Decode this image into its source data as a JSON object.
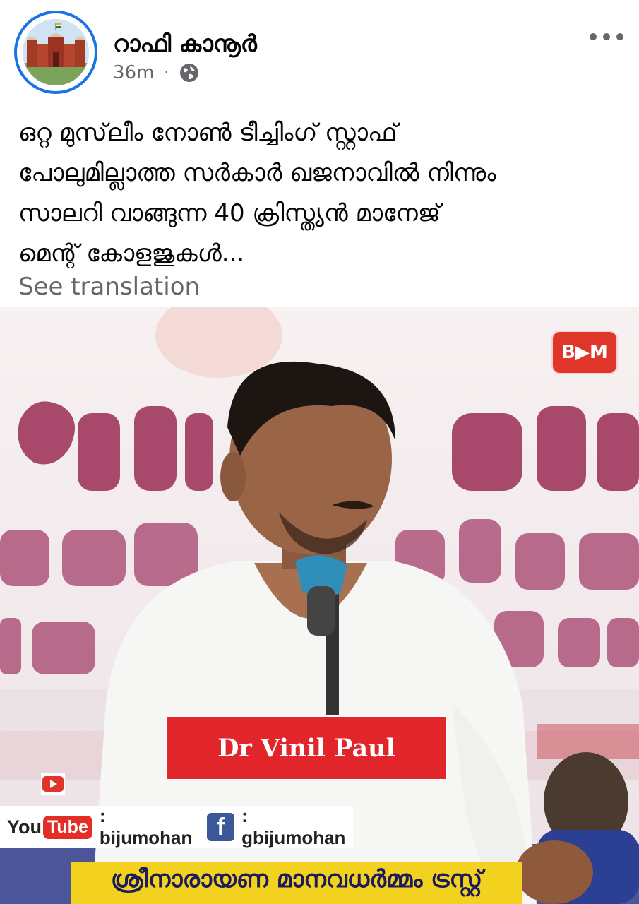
{
  "post": {
    "author": "റാഫി കാനൂർ",
    "time": "36m",
    "separator": "·",
    "text": "ഒറ്റ മുസ്‌ലീം നോൺ ടീച്ചിംഗ് സ്റ്റാഫ്\nപോലുമില്ലാത്ത സർകാർ ഖജനാവിൽ നിന്നും\nസാലറി വാങ്ങുന്ന 40 ക്രിസ്ത്യൻ മാനേജ്\nമെന്റ് കോളജുകൾ...",
    "see_translation": "See translation"
  },
  "video": {
    "logo_text": "B▶M",
    "name_plate": "Dr Vinil Paul",
    "youtube_word": "You",
    "youtube_box": "Tube",
    "youtube_handle": ": bijumohan",
    "facebook_letter": "f",
    "facebook_handle": ": gbijumohan",
    "banner_text": "ശ്രീനാരായണ മാനവധർമ്മം ട്രസ്റ്റ്"
  }
}
